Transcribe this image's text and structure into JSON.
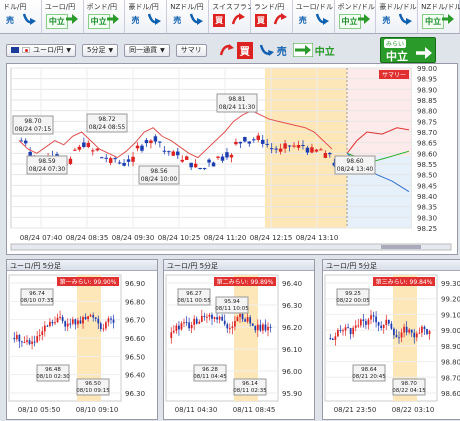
{
  "currency_bar": [
    {
      "pair": "ドル/円",
      "signal": "売",
      "type": "sell"
    },
    {
      "pair": "ユーロ/円",
      "signal": "中立",
      "type": "neu"
    },
    {
      "pair": "ポンド/円",
      "signal": "中立",
      "type": "neu"
    },
    {
      "pair": "豪ドル/円",
      "signal": "売",
      "type": "sell"
    },
    {
      "pair": "NZドル/円",
      "signal": "売",
      "type": "sell"
    },
    {
      "pair": "スイスフラン/円",
      "signal": "買",
      "type": "buy"
    },
    {
      "pair": "ランド/円",
      "signal": "買",
      "type": "buy"
    },
    {
      "pair": "ユーロ/ドル",
      "signal": "売",
      "type": "sell"
    },
    {
      "pair": "ポンド/ドル",
      "signal": "中立",
      "type": "neu"
    },
    {
      "pair": "豪ドル/ドル",
      "signal": "売",
      "type": "sell"
    },
    {
      "pair": "NZドル/ドル",
      "signal": "中立",
      "type": "neu"
    }
  ],
  "toolbar": {
    "pair_select": "ユーロ/円",
    "interval_select": "5分足",
    "mode_select": "同一通貨",
    "summary_button": "サマリ",
    "buy_label": "買",
    "sell_label": "売",
    "neutral_label": "中立"
  },
  "forecast_badge": {
    "label": "みらい",
    "value": "中立"
  },
  "main_chart": {
    "summary_tag": "サマリー",
    "y_ticks": [
      "99.00",
      "98.95",
      "98.90",
      "98.85",
      "98.80",
      "98.75",
      "98.70",
      "98.65",
      "98.60",
      "98.55",
      "98.50",
      "98.45",
      "98.40",
      "98.35",
      "98.30",
      "98.25"
    ],
    "x_ticks": [
      "08/24 07:40",
      "08/24 08:35",
      "08/24 09:30",
      "08/24 10:25",
      "08/24 11:20",
      "08/24 12:15",
      "08/24 13:10"
    ],
    "callouts": [
      {
        "price": "98.70",
        "time": "08/24 07:15"
      },
      {
        "price": "98.59",
        "time": "08/24 07:30"
      },
      {
        "price": "98.72",
        "time": "08/24 08:55"
      },
      {
        "price": "98.56",
        "time": "08/24 10:00"
      },
      {
        "price": "98.81",
        "time": "08/24 11:30"
      },
      {
        "price": "98.60",
        "time": "08/24 13:40"
      }
    ]
  },
  "mini_charts": [
    {
      "title": "ユーロ/円 5分足",
      "similarity": "第一みらい: 99.90%",
      "y_ticks": [
        "96.90",
        "96.80",
        "96.70",
        "96.60",
        "96.50",
        "96.40",
        "96.30"
      ],
      "x_ticks": [
        "08/10 05:50",
        "08/10 09:10"
      ],
      "callouts": [
        {
          "price": "96.74",
          "time": "08/10 07:35"
        },
        {
          "price": "96.48",
          "time": "08/10 02:30"
        },
        {
          "price": "96.50",
          "time": "08/10 09:15"
        }
      ]
    },
    {
      "title": "ユーロ/円 5分足",
      "similarity": "第二みらい: 99.89%",
      "y_ticks": [
        "96.40",
        "96.30",
        "96.20",
        "96.10",
        "96.00",
        "95.90"
      ],
      "x_ticks": [
        "08/11 04:30",
        "08/11 08:45"
      ],
      "callouts": [
        {
          "price": "96.27",
          "time": "08/11 00:55"
        },
        {
          "price": "96.28",
          "time": "08/11 04:45"
        },
        {
          "price": "96.14",
          "time": "08/11 02:35"
        },
        {
          "price": "95.94",
          "time": "08/11 10:05"
        }
      ]
    },
    {
      "title": "ユーロ/円 5分足",
      "similarity": "第三みらい: 99.84%",
      "y_ticks": [
        "99.30",
        "99.20",
        "99.10",
        "99.00",
        "98.90",
        "98.80",
        "98.70",
        "98.60"
      ],
      "x_ticks": [
        "08/21 23:50",
        "08/22 03:10"
      ],
      "callouts": [
        {
          "price": "99.25",
          "time": "08/22 00:05"
        },
        {
          "price": "98.64",
          "time": "08/21 20:45"
        },
        {
          "price": "98.70",
          "time": "08/22 04:15"
        }
      ]
    }
  ]
}
